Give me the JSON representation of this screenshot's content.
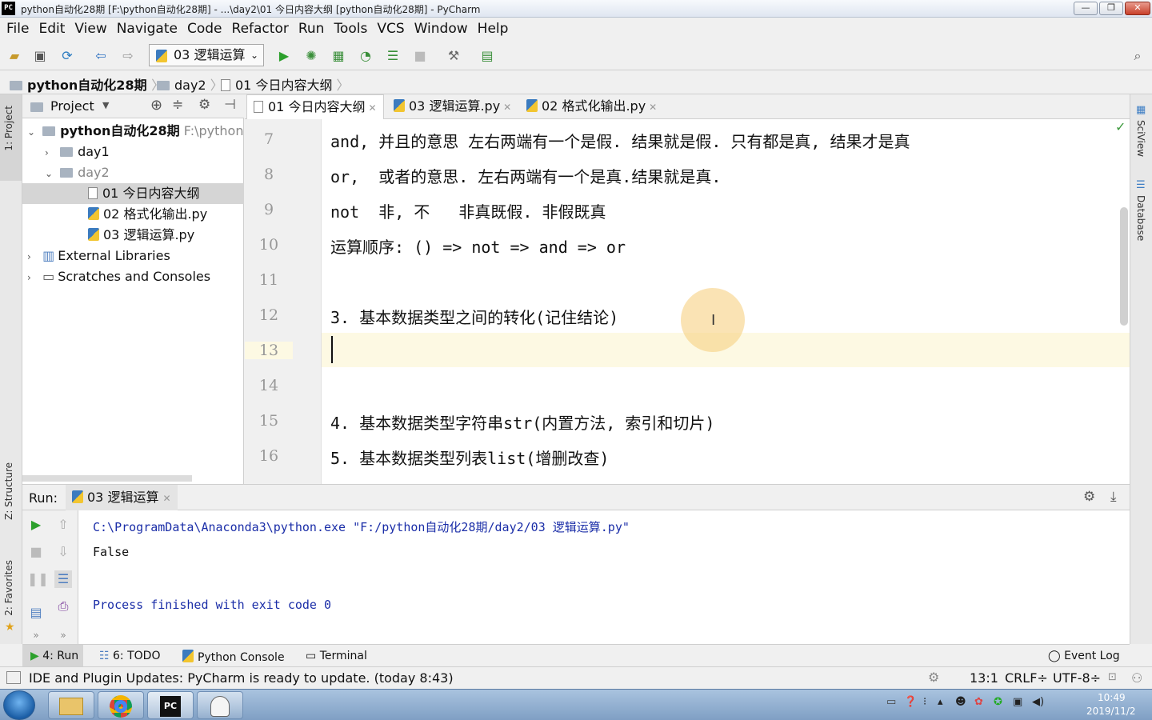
{
  "window": {
    "title": "python自动化28期 [F:\\python自动化28期] - ...\\day2\\01 今日内容大纲 [python自动化28期] - PyCharm",
    "logo": "PC",
    "minimize": "—",
    "restore": "❐",
    "close": "✕"
  },
  "menu": [
    "File",
    "Edit",
    "View",
    "Navigate",
    "Code",
    "Refactor",
    "Run",
    "Tools",
    "VCS",
    "Window",
    "Help"
  ],
  "toolbar": {
    "run_config": "03 逻辑运算"
  },
  "breadcrumb": [
    "python自动化28期",
    "day2",
    "01 今日内容大纲"
  ],
  "left_strip": {
    "project": "1: Project",
    "structure": "Z: Structure",
    "favorites": "2: Favorites"
  },
  "right_strip": {
    "sciview": "SciView",
    "database": "Database"
  },
  "project": {
    "header": "Project",
    "root": {
      "name": "python自动化28期",
      "path": "F:\\python"
    },
    "items": [
      "day1",
      "day2",
      "01 今日内容大纲",
      "02 格式化输出.py",
      "03 逻辑运算.py",
      "External Libraries",
      "Scratches and Consoles"
    ]
  },
  "tabs": [
    "01 今日内容大纲",
    "03 逻辑运算.py",
    "02 格式化输出.py"
  ],
  "editor": {
    "line_numbers": [
      "7",
      "8",
      "9",
      "10",
      "11",
      "12",
      "13",
      "14",
      "15",
      "16"
    ],
    "lines": [
      "and, 并且的意思 左右两端有一个是假. 结果就是假. 只有都是真, 结果才是真",
      "or,  或者的意思. 左右两端有一个是真.结果就是真.",
      "not  非, 不   非真既假. 非假既真",
      "运算顺序: () => not => and => or",
      "",
      "3. 基本数据类型之间的转化(记住结论)",
      "",
      "",
      "4. 基本数据类型字符串str(内置方法, 索引和切片)",
      "5. 基本数据类型列表list(增删改查)"
    ]
  },
  "run": {
    "label": "Run:",
    "tab": "03 逻辑运算",
    "output": [
      "C:\\ProgramData\\Anaconda3\\python.exe \"F:/python自动化28期/day2/03 逻辑运算.py\"",
      "False",
      "",
      "Process finished with exit code 0"
    ]
  },
  "bottom_tabs": {
    "run": "4: Run",
    "todo": "6: TODO",
    "console": "Python Console",
    "terminal": "Terminal",
    "event_log": "Event Log"
  },
  "status": {
    "message": "IDE and Plugin Updates: PyCharm is ready to update. (today 8:43)",
    "position": "13:1",
    "line_sep": "CRLF÷",
    "encoding": "UTF-8÷"
  },
  "taskbar": {
    "time": "10:49",
    "date": "2019/11/2"
  },
  "colors": {
    "accent": "#3d8d3d",
    "console_blue": "#1b2ea8",
    "caret_line": "#fdf9e3",
    "selection": "#d5d5d5"
  }
}
